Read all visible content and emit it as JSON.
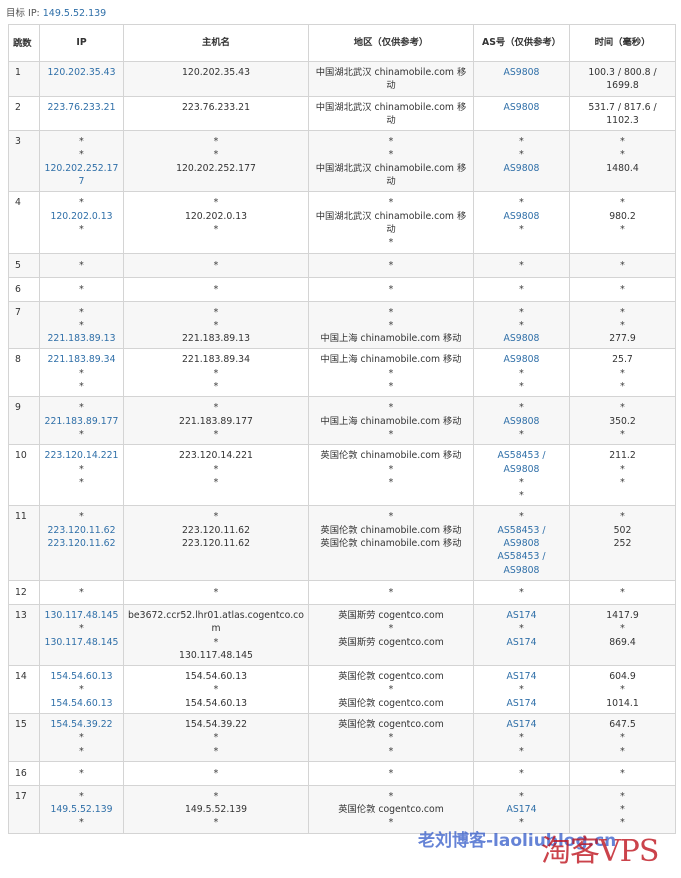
{
  "target": {
    "label": "目标 IP:",
    "ip": "149.5.52.139"
  },
  "headers": {
    "hop": "跳数",
    "ip": "IP",
    "host": "主机名",
    "region": "地区（仅供参考）",
    "as": "AS号（仅供参考）",
    "time": "时间（毫秒）"
  },
  "rows": [
    {
      "hop": "1",
      "ip": [
        "120.202.35.43"
      ],
      "host": [
        "120.202.35.43"
      ],
      "region": [
        "中国湖北武汉 chinamobile.com 移动"
      ],
      "as": [
        "AS9808"
      ],
      "time": [
        "100.3 / 800.8 / 1699.8"
      ]
    },
    {
      "hop": "2",
      "ip": [
        "223.76.233.21"
      ],
      "host": [
        "223.76.233.21"
      ],
      "region": [
        "中国湖北武汉 chinamobile.com 移动"
      ],
      "as": [
        "AS9808"
      ],
      "time": [
        "531.7 / 817.6 / 1102.3"
      ]
    },
    {
      "hop": "3",
      "ip": [
        "*",
        "*",
        "120.202.252.177"
      ],
      "host": [
        "*",
        "*",
        "120.202.252.177"
      ],
      "region": [
        "*",
        "*",
        "中国湖北武汉 chinamobile.com 移动"
      ],
      "as": [
        "*",
        "*",
        "AS9808"
      ],
      "time": [
        "*",
        "*",
        "1480.4"
      ]
    },
    {
      "hop": "4",
      "ip": [
        "*",
        "120.202.0.13",
        "*"
      ],
      "host": [
        "*",
        "120.202.0.13",
        "*"
      ],
      "region": [
        "*",
        "中国湖北武汉 chinamobile.com 移动",
        "*"
      ],
      "as": [
        "*",
        "AS9808",
        "*"
      ],
      "time": [
        "*",
        "980.2",
        "*"
      ]
    },
    {
      "hop": "5",
      "ip": [
        "*"
      ],
      "host": [
        "*"
      ],
      "region": [
        "*"
      ],
      "as": [
        "*"
      ],
      "time": [
        "*"
      ]
    },
    {
      "hop": "6",
      "ip": [
        "*"
      ],
      "host": [
        "*"
      ],
      "region": [
        "*"
      ],
      "as": [
        "*"
      ],
      "time": [
        "*"
      ]
    },
    {
      "hop": "7",
      "ip": [
        "*",
        "*",
        "221.183.89.13"
      ],
      "host": [
        "*",
        "*",
        "221.183.89.13"
      ],
      "region": [
        "*",
        "*",
        "中国上海 chinamobile.com 移动"
      ],
      "as": [
        "*",
        "*",
        "AS9808"
      ],
      "time": [
        "*",
        "*",
        "277.9"
      ]
    },
    {
      "hop": "8",
      "ip": [
        "221.183.89.34",
        "*",
        "*"
      ],
      "host": [
        "221.183.89.34",
        "*",
        "*"
      ],
      "region": [
        "中国上海 chinamobile.com 移动",
        "*",
        "*"
      ],
      "as": [
        "AS9808",
        "*",
        "*"
      ],
      "time": [
        "25.7",
        "*",
        "*"
      ]
    },
    {
      "hop": "9",
      "ip": [
        "*",
        "221.183.89.177",
        "*"
      ],
      "host": [
        "*",
        "221.183.89.177",
        "*"
      ],
      "region": [
        "*",
        "中国上海 chinamobile.com 移动",
        "*"
      ],
      "as": [
        "*",
        "AS9808",
        "*"
      ],
      "time": [
        "*",
        "350.2",
        "*"
      ]
    },
    {
      "hop": "10",
      "ip": [
        "223.120.14.221",
        "*",
        "*"
      ],
      "host": [
        "223.120.14.221",
        "*",
        "*"
      ],
      "region": [
        "英国伦敦 chinamobile.com 移动",
        "*",
        "*"
      ],
      "as": [
        "AS58453 /",
        "AS9808",
        "*",
        "*"
      ],
      "time": [
        "211.2",
        "*",
        "*"
      ]
    },
    {
      "hop": "11",
      "ip": [
        "*",
        "223.120.11.62",
        "223.120.11.62"
      ],
      "host": [
        "*",
        "223.120.11.62",
        "223.120.11.62"
      ],
      "region": [
        "*",
        "英国伦敦 chinamobile.com 移动",
        "英国伦敦 chinamobile.com 移动"
      ],
      "as": [
        "*",
        "AS58453 /",
        "AS9808",
        "AS58453 /",
        "AS9808"
      ],
      "time": [
        "*",
        "502",
        "252"
      ]
    },
    {
      "hop": "12",
      "ip": [
        "*"
      ],
      "host": [
        "*"
      ],
      "region": [
        "*"
      ],
      "as": [
        "*"
      ],
      "time": [
        "*"
      ]
    },
    {
      "hop": "13",
      "ip": [
        "130.117.48.145",
        "*",
        "130.117.48.145"
      ],
      "host": [
        "be3672.ccr52.lhr01.atlas.cogentco.com",
        "*",
        "130.117.48.145"
      ],
      "region": [
        "英国斯劳 cogentco.com",
        "*",
        "英国斯劳 cogentco.com"
      ],
      "as": [
        "AS174",
        "*",
        "AS174"
      ],
      "time": [
        "1417.9",
        "*",
        "869.4"
      ]
    },
    {
      "hop": "14",
      "ip": [
        "154.54.60.13",
        "*",
        "154.54.60.13"
      ],
      "host": [
        "154.54.60.13",
        "*",
        "154.54.60.13"
      ],
      "region": [
        "英国伦敦 cogentco.com",
        "*",
        "英国伦敦 cogentco.com"
      ],
      "as": [
        "AS174",
        "*",
        "AS174"
      ],
      "time": [
        "604.9",
        "*",
        "1014.1"
      ]
    },
    {
      "hop": "15",
      "ip": [
        "154.54.39.22",
        "*",
        "*"
      ],
      "host": [
        "154.54.39.22",
        "*",
        "*"
      ],
      "region": [
        "英国伦敦 cogentco.com",
        "*",
        "*"
      ],
      "as": [
        "AS174",
        "*",
        "*"
      ],
      "time": [
        "647.5",
        "*",
        "*"
      ]
    },
    {
      "hop": "16",
      "ip": [
        "*"
      ],
      "host": [
        "*"
      ],
      "region": [
        "*"
      ],
      "as": [
        "*"
      ],
      "time": [
        "*"
      ]
    },
    {
      "hop": "17",
      "ip": [
        "*",
        "149.5.52.139",
        "*"
      ],
      "host": [
        "*",
        "149.5.52.139",
        "*"
      ],
      "region": [
        "*",
        "英国伦敦 cogentco.com",
        "*"
      ],
      "as": [
        "*",
        "AS174",
        "*"
      ],
      "time": [
        "*",
        "*",
        "*"
      ]
    }
  ],
  "watermark": {
    "text": "老刘博客-laoliublog.cn",
    "logo": "淘客VPS"
  },
  "colors": {
    "link": "#2f6fa8",
    "border": "#d4d4d4",
    "stripe": "#f7f7f7"
  }
}
